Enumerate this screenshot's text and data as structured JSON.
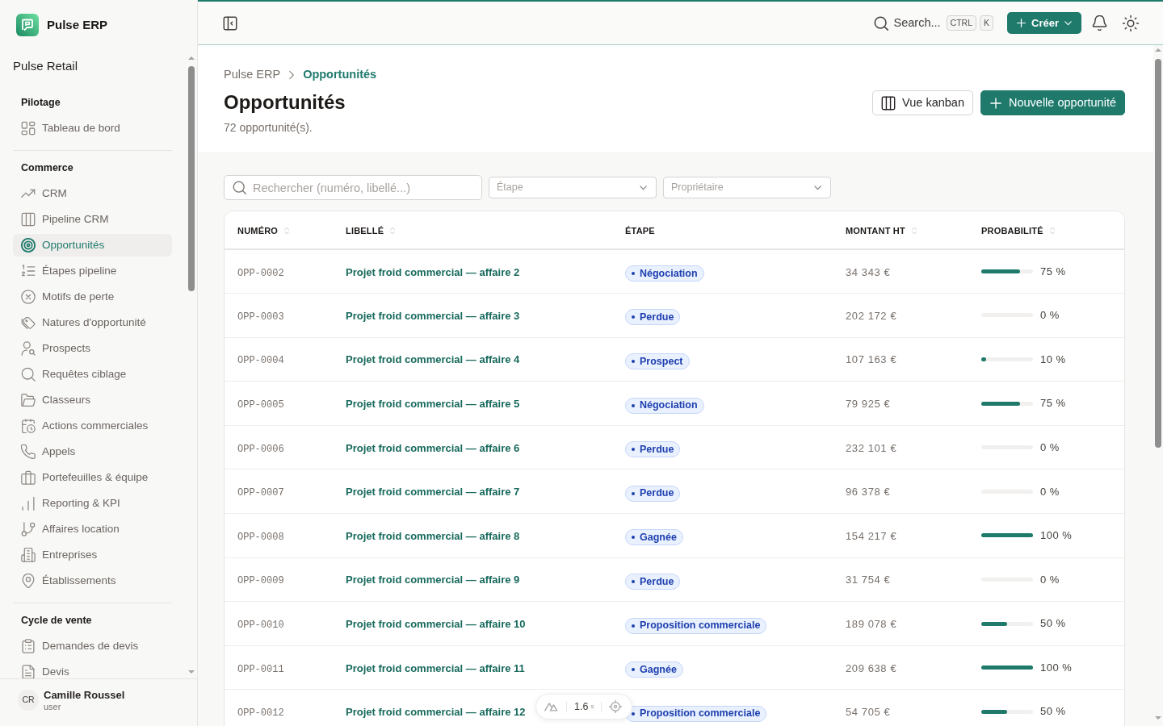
{
  "app": {
    "name": "Pulse ERP"
  },
  "sidebar": {
    "workspace": "Pulse Retail",
    "sections": [
      {
        "title": "Pilotage",
        "items": [
          {
            "label": "Tableau de bord",
            "selected": false
          }
        ]
      },
      {
        "title": "Commerce",
        "items": [
          {
            "label": "CRM",
            "selected": false
          },
          {
            "label": "Pipeline CRM",
            "selected": false
          },
          {
            "label": "Opportunités",
            "selected": true
          },
          {
            "label": "Étapes pipeline",
            "selected": false
          },
          {
            "label": "Motifs de perte",
            "selected": false
          },
          {
            "label": "Natures d'opportunité",
            "selected": false
          },
          {
            "label": "Prospects",
            "selected": false
          },
          {
            "label": "Requêtes ciblage",
            "selected": false
          },
          {
            "label": "Classeurs",
            "selected": false
          },
          {
            "label": "Actions commerciales",
            "selected": false
          },
          {
            "label": "Appels",
            "selected": false
          },
          {
            "label": "Portefeuilles & équipe",
            "selected": false
          },
          {
            "label": "Reporting & KPI",
            "selected": false
          },
          {
            "label": "Affaires location",
            "selected": false
          },
          {
            "label": "Entreprises",
            "selected": false
          },
          {
            "label": "Établissements",
            "selected": false
          }
        ]
      },
      {
        "title": "Cycle de vente",
        "items": [
          {
            "label": "Demandes de devis",
            "selected": false
          },
          {
            "label": "Devis",
            "selected": false
          }
        ]
      }
    ],
    "user": {
      "initials": "CR",
      "name": "Camille Roussel",
      "role": "user"
    }
  },
  "topbar": {
    "search": {
      "label": "Search..."
    },
    "shortcut": [
      "CTRL",
      "K"
    ],
    "create_button": {
      "label": "Créer"
    }
  },
  "page": {
    "breadcrumb": [
      {
        "label": "Pulse ERP",
        "current": false
      },
      {
        "label": "Opportunités",
        "current": true
      }
    ],
    "title": "Opportunités",
    "subtitle": "72 opportunité(s).",
    "actions": [
      {
        "label": "Vue kanban",
        "kind": "outline"
      },
      {
        "label": "Nouvelle opportunité",
        "kind": "primary"
      }
    ]
  },
  "filters": {
    "search": {
      "placeholder": "Rechercher (numéro, libellé...)"
    },
    "selects": [
      {
        "placeholder": "Étape"
      },
      {
        "placeholder": "Propriétaire"
      }
    ]
  },
  "table": {
    "columns": [
      {
        "label": "NUMÉRO",
        "sortable": true
      },
      {
        "label": "LIBELLÉ",
        "sortable": true
      },
      {
        "label": "ÉTAPE",
        "sortable": false
      },
      {
        "label": "MONTANT HT",
        "sortable": true
      },
      {
        "label": "PROBABILITÉ",
        "sortable": true
      }
    ],
    "rows": [
      {
        "number": "OPP-0002",
        "label": "Projet froid commercial — affaire 2",
        "stage": "Négociation",
        "amount": "34 343 €",
        "probability": {
          "level": 0.75,
          "reading": "75 %"
        }
      },
      {
        "number": "OPP-0003",
        "label": "Projet froid commercial — affaire 3",
        "stage": "Perdue",
        "amount": "202 172 €",
        "probability": {
          "level": 0,
          "reading": "0 %"
        }
      },
      {
        "number": "OPP-0004",
        "label": "Projet froid commercial — affaire 4",
        "stage": "Prospect",
        "amount": "107 163 €",
        "probability": {
          "level": 0.1,
          "reading": "10 %"
        }
      },
      {
        "number": "OPP-0005",
        "label": "Projet froid commercial — affaire 5",
        "stage": "Négociation",
        "amount": "79 925 €",
        "probability": {
          "level": 0.75,
          "reading": "75 %"
        }
      },
      {
        "number": "OPP-0006",
        "label": "Projet froid commercial — affaire 6",
        "stage": "Perdue",
        "amount": "232 101 €",
        "probability": {
          "level": 0,
          "reading": "0 %"
        }
      },
      {
        "number": "OPP-0007",
        "label": "Projet froid commercial — affaire 7",
        "stage": "Perdue",
        "amount": "96 378 €",
        "probability": {
          "level": 0,
          "reading": "0 %"
        }
      },
      {
        "number": "OPP-0008",
        "label": "Projet froid commercial — affaire 8",
        "stage": "Gagnée",
        "amount": "154 217 €",
        "probability": {
          "level": 1,
          "reading": "100 %"
        }
      },
      {
        "number": "OPP-0009",
        "label": "Projet froid commercial — affaire 9",
        "stage": "Perdue",
        "amount": "31 754 €",
        "probability": {
          "level": 0,
          "reading": "0 %"
        }
      },
      {
        "number": "OPP-0010",
        "label": "Projet froid commercial — affaire 10",
        "stage": "Proposition commerciale",
        "amount": "189 078 €",
        "probability": {
          "level": 0.5,
          "reading": "50 %"
        }
      },
      {
        "number": "OPP-0011",
        "label": "Projet froid commercial — affaire 11",
        "stage": "Gagnée",
        "amount": "209 638 €",
        "probability": {
          "level": 1,
          "reading": "100 %"
        }
      },
      {
        "number": "OPP-0012",
        "label": "Projet froid commercial — affaire 12",
        "stage": "Proposition commerciale",
        "amount": "54 705 €",
        "probability": {
          "level": 0.5,
          "reading": "50 %"
        }
      }
    ]
  },
  "devtools": {
    "time": "1.6",
    "unit": "s"
  }
}
